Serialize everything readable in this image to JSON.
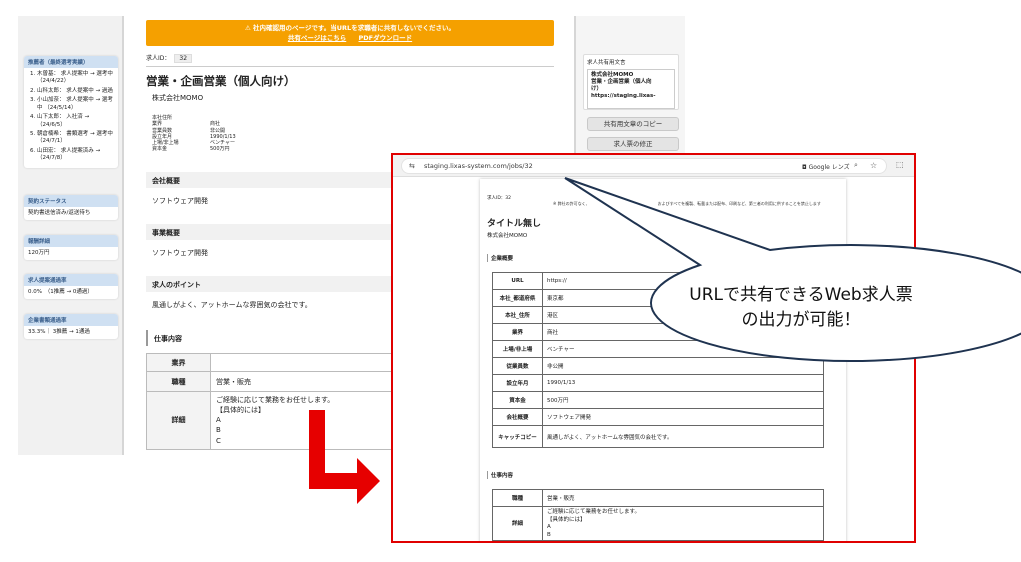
{
  "base": {
    "sidebar": {
      "cards": [
        {
          "title": "推薦者（最終選考実績）",
          "items": [
            "木曽基： 求人提案中 → 選考中 （24/4/22）",
            "山科太郎： 求人提案中 → 過過",
            "小山加奈： 求人提案中 → 選考中 （24/5/14）",
            "山下太郎： 入社済 → （24/6/5）",
            "朝倉楠希： 書類選考 → 選考中 （24/7/1）",
            "山田宏： 求人提案済み → （24/7/8）"
          ]
        },
        {
          "title": "契約ステータス",
          "body": "契約書送信済み/返送待ち"
        },
        {
          "title": "報酬詳細",
          "body": "120万円"
        },
        {
          "title": "求人提案通過率",
          "body": "0.0%　（1推薦 → 0通過）"
        },
        {
          "title": "企業書類通過率",
          "body": "33.3%｜ 3推薦 → 1通過"
        }
      ]
    },
    "main": {
      "banner": "⚠ 社内確認用のページです。当URLを求職者に共有しないでください。",
      "banner_link_share": "共有ページはこちら",
      "banner_link_pdf": "PDFダウンロード",
      "job_id_label": "求人ID：",
      "job_id": "32",
      "title": "営業・企画営業（個人向け）",
      "company": "株式会社MOMO",
      "meta": [
        {
          "k": "本社住所",
          "v": ""
        },
        {
          "k": "業界",
          "v": "商社"
        },
        {
          "k": "営業員数",
          "v": "非公開"
        },
        {
          "k": "設立年月",
          "v": "1990/1/13"
        },
        {
          "k": "上場/非上場",
          "v": "ベンチャー"
        },
        {
          "k": "資本金",
          "v": "500万円"
        }
      ],
      "sections": [
        {
          "heading": "会社概要",
          "text": "ソフトウェア開発"
        },
        {
          "heading": "事業概要",
          "text": "ソフトウェア開発"
        },
        {
          "heading": "求人のポイント",
          "text": "風通しがよく、アットホームな雰囲気の会社です。"
        }
      ],
      "work_heading": "仕事内容",
      "work_rows": [
        {
          "k": "業界",
          "v": ""
        },
        {
          "k": "職種",
          "v": "営業・販売"
        },
        {
          "k": "詳細",
          "lines": [
            "ご経験に応じて業務をお任せします。",
            "【具体的には】",
            "A",
            "B",
            "C"
          ]
        }
      ]
    },
    "right": {
      "share_label": "求人共有用文言",
      "share_lines": [
        "株式会社MOMO",
        "営業・企画営業（個人向",
        "け）",
        "https://staging.lixas-"
      ],
      "copy_button": "共有用文章のコピー",
      "edit_button": "求人票の修正"
    }
  },
  "browser": {
    "url": "staging.lixas-system.com/jobs/32",
    "lens_label": "Google レンズ",
    "icons": {
      "tune": "tune-icon",
      "zoom": "zoom-icon",
      "star": "star-icon",
      "extension": "extension-icon"
    },
    "page": {
      "job_id": "求人ID：32",
      "notice": "※ 弊社の許可なく、　　　　　　　　　　　　　　　　　およびすべてを複製、転載または配布、印刷など、第三者の利用に供することを禁止します",
      "title": "タイトル無し",
      "company": "株式会社MOMO",
      "company_heading": "企業概要",
      "company_rows": [
        {
          "k": "URL",
          "v": "https://"
        },
        {
          "k": "本社_都道府県",
          "v": "東京都"
        },
        {
          "k": "本社_住所",
          "v": "港区"
        },
        {
          "k": "業界",
          "v": "商社"
        },
        {
          "k": "上場/非上場",
          "v": "ベンチャー"
        },
        {
          "k": "従業員数",
          "v": "非公開"
        },
        {
          "k": "設立年月",
          "v": "1990/1/13"
        },
        {
          "k": "資本金",
          "v": "500万円"
        },
        {
          "k": "会社概要",
          "v": "ソフトウェア開発"
        },
        {
          "k": "キャッチコピー",
          "v": "風通しがよく、アットホームな雰囲気の会社です。"
        }
      ],
      "work_heading": "仕事内容",
      "work_rows": [
        {
          "k": "職種",
          "v": "営業・販売"
        },
        {
          "k": "詳細",
          "lines": [
            "ご経験に応じて業務をお任せします。",
            "【具体的には】",
            "A",
            "B"
          ]
        }
      ]
    }
  },
  "callout": {
    "line1": "URLで共有できるWeb求人票",
    "line2": "の出力が可能！"
  },
  "colors": {
    "banner": "#f5a000",
    "frame": "#e00000",
    "arrow": "#e60000",
    "bubble_stroke": "#1f3350"
  }
}
